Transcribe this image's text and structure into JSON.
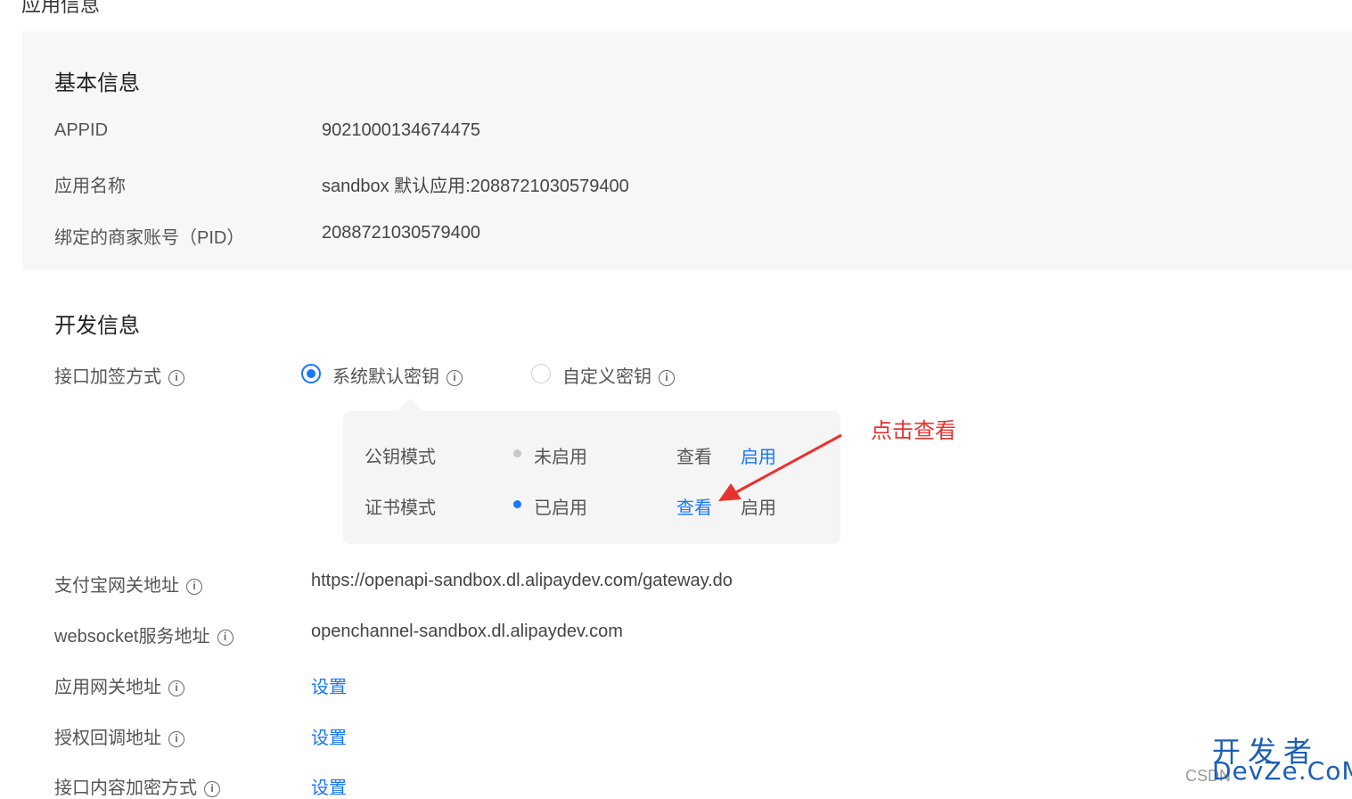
{
  "page": {
    "cut_title": "应用信息"
  },
  "basic_info": {
    "title": "基本信息",
    "rows": [
      {
        "label": "APPID",
        "value": "9021000134674475"
      },
      {
        "label": "应用名称",
        "value": "sandbox 默认应用:2088721030579400"
      },
      {
        "label": "绑定的商家账号（PID）",
        "value": "2088721030579400"
      }
    ]
  },
  "dev_info": {
    "title": "开发信息",
    "sign_method": {
      "label": "接口加签方式",
      "options": [
        {
          "label": "系统默认密钥",
          "selected": true
        },
        {
          "label": "自定义密钥",
          "selected": false
        }
      ]
    },
    "popover": {
      "rows": [
        {
          "mode": "公钥模式",
          "status": "未启用",
          "status_color": "#c8c8c8",
          "view": "查看",
          "enable": "启用"
        },
        {
          "mode": "证书模式",
          "status": "已启用",
          "status_color": "#1677ff",
          "view": "查看",
          "enable": "启用"
        }
      ]
    },
    "gateway": {
      "label": "支付宝网关地址",
      "value": "https://openapi-sandbox.dl.alipaydev.com/gateway.do"
    },
    "websocket": {
      "label": "websocket服务地址",
      "value": "openchannel-sandbox.dl.alipaydev.com"
    },
    "app_gateway": {
      "label": "应用网关地址",
      "link": "设置"
    },
    "auth_callback": {
      "label": "授权回调地址",
      "link": "设置"
    },
    "encryption": {
      "label": "接口内容加密方式",
      "link": "设置"
    }
  },
  "annotation": {
    "text": "点击查看",
    "color": "#e8322f"
  },
  "watermark": {
    "line1": "开发者",
    "line2": "DevZe.CoM",
    "small": "CSDN"
  },
  "colors": {
    "accent": "#1677ff",
    "panel_bg": "#f7f7f7"
  }
}
